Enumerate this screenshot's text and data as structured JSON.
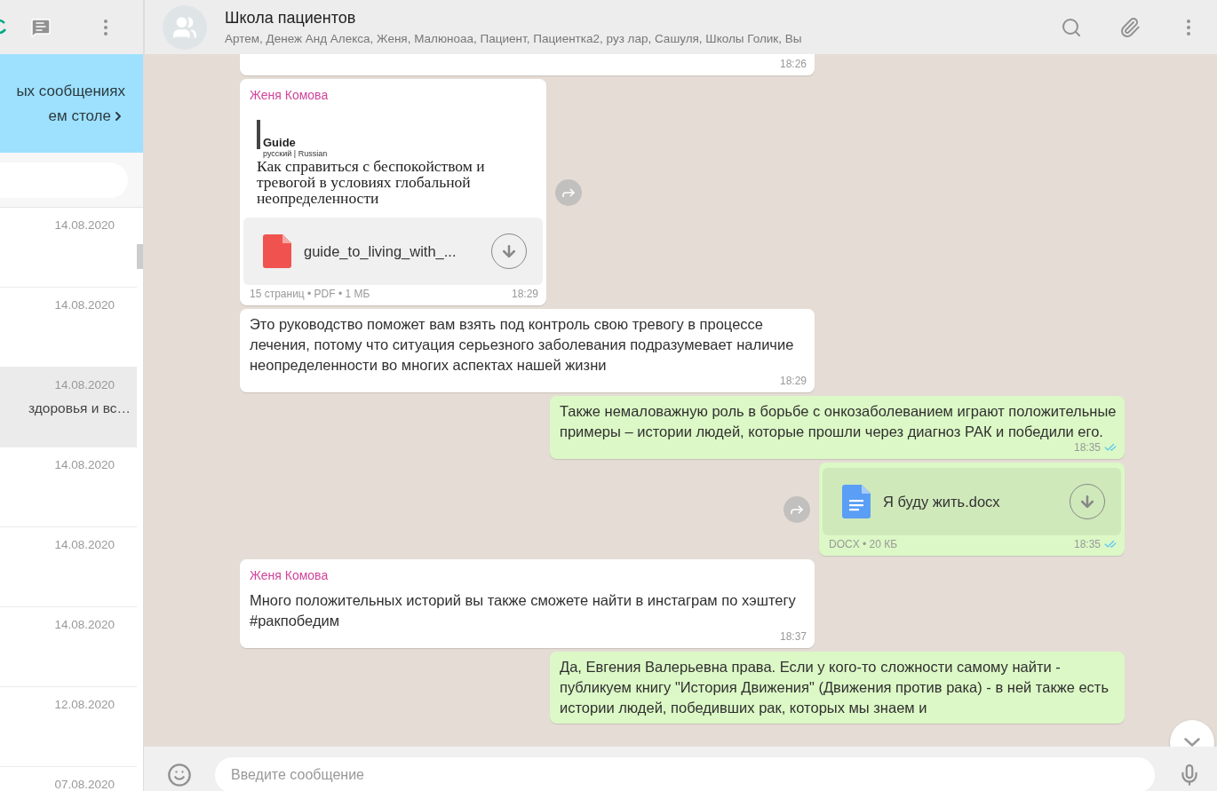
{
  "sidebar": {
    "banner": {
      "line_1": "ых сообщениях",
      "line_2": "ем столе"
    },
    "chats": [
      {
        "date": "14.08.2020",
        "selected": false
      },
      {
        "date": "14.08.2020",
        "selected": false
      },
      {
        "date": "14.08.2020",
        "preview": "здоровья и вс…",
        "selected": true
      },
      {
        "date": "14.08.2020",
        "selected": false
      },
      {
        "date": "14.08.2020",
        "selected": false
      },
      {
        "date": "14.08.2020",
        "selected": false
      },
      {
        "date": "12.08.2020",
        "selected": false
      },
      {
        "date": "07.08.2020",
        "selected": false
      }
    ]
  },
  "chat": {
    "title": "Школа пациентов",
    "members": "Артем, Денеж Анд Алекса, Женя, Малюноаа, Пациент, Пациентка2, руз лар, Сашуля, Школы Голик, Вы"
  },
  "messages": [
    {
      "kind": "text",
      "outgoing": false,
      "time": "18:26"
    },
    {
      "kind": "pdf",
      "outgoing": false,
      "sender": "Женя Комова",
      "preview": {
        "brand": "Guide",
        "language": "русский | Russian",
        "title": "Как справиться с беспокойством и тревогой в условиях глобальной неопределенности"
      },
      "file_name": "guide_to_living_with_...",
      "meta": "15 страниц • PDF • 1 МБ",
      "time": "18:29"
    },
    {
      "kind": "text",
      "outgoing": false,
      "text": "Это руководство поможет вам взять под контроль свою тревогу в процессе лечения, потому что ситуация серьезного заболевания подразумевает наличие неопределенности во многих аспектах нашей жизни",
      "time": "18:29"
    },
    {
      "kind": "text",
      "outgoing": true,
      "text": "Также немаловажную роль в борьбе с онкозаболеванием играют положительные примеры – истории  людей, которые прошли через диагноз РАК и победили его.",
      "time": "18:35",
      "read": true
    },
    {
      "kind": "doc",
      "outgoing": true,
      "file_name": "Я буду жить.docx",
      "meta": "DOCX • 20 КБ",
      "time": "18:35",
      "read": true
    },
    {
      "kind": "text",
      "outgoing": false,
      "sender": "Женя Комова",
      "text": "Много положительных историй вы также сможете найти в инстаграм по хэштегу #ракпобедим",
      "time": "18:37"
    },
    {
      "kind": "text",
      "outgoing": true,
      "text": "Да, Евгения Валерьевна права. Если у кого-то сложности самому найти - публикуем книгу \"История Движения\" (Движения против рака) - в ней также есть  истории людей, победивших рак, которых мы знаем и"
    }
  ],
  "composer": {
    "placeholder": "Введите сообщение"
  }
}
